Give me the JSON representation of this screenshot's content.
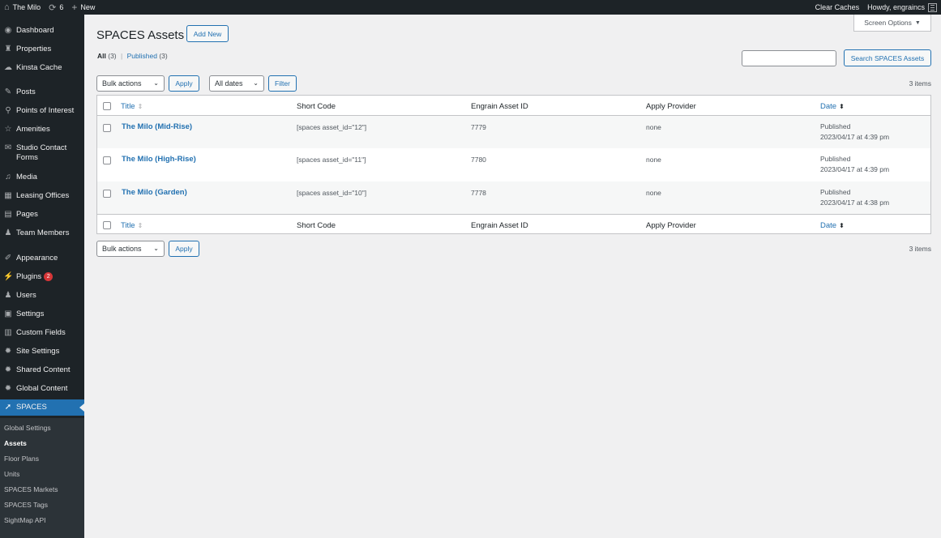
{
  "adminbar": {
    "site_name": "The Milo",
    "updates_count": "6",
    "new_label": "New",
    "clear_caches": "Clear Caches",
    "howdy": "Howdy, engraincs"
  },
  "sidebar": {
    "items": [
      {
        "label": "Dashboard",
        "icon": "dashboard-icon"
      },
      {
        "label": "Properties",
        "icon": "properties-icon"
      },
      {
        "label": "Kinsta Cache",
        "icon": "cloud-icon"
      },
      {
        "label": "Posts",
        "icon": "pin-icon"
      },
      {
        "label": "Points of Interest",
        "icon": "location-icon"
      },
      {
        "label": "Amenities",
        "icon": "star-icon"
      },
      {
        "label": "Studio Contact Forms",
        "icon": "mailbox-icon"
      },
      {
        "label": "Media",
        "icon": "media-icon"
      },
      {
        "label": "Leasing Offices",
        "icon": "building-icon"
      },
      {
        "label": "Pages",
        "icon": "page-icon"
      },
      {
        "label": "Team Members",
        "icon": "user-icon"
      },
      {
        "label": "Appearance",
        "icon": "brush-icon"
      },
      {
        "label": "Plugins",
        "icon": "plug-icon",
        "badge": "2"
      },
      {
        "label": "Users",
        "icon": "users-icon"
      },
      {
        "label": "Settings",
        "icon": "settings-icon"
      },
      {
        "label": "Custom Fields",
        "icon": "fields-icon"
      },
      {
        "label": "Site Settings",
        "icon": "gear-icon"
      },
      {
        "label": "Shared Content",
        "icon": "gear-icon"
      },
      {
        "label": "Global Content",
        "icon": "gear-icon"
      },
      {
        "label": "SPACES",
        "icon": "spaces-icon"
      }
    ],
    "submenu": [
      "Global Settings",
      "Assets",
      "Floor Plans",
      "Units",
      "SPACES Markets",
      "SPACES Tags",
      "SightMap API"
    ]
  },
  "page": {
    "title": "SPACES Assets",
    "add_new": "Add New",
    "screen_options": "Screen Options",
    "filter_all": "All",
    "filter_all_count": "(3)",
    "filter_sep": "|",
    "filter_published": "Published",
    "filter_published_count": "(3)",
    "search_value": "",
    "search_button": "Search SPACES Assets",
    "bulk_actions": "Bulk actions",
    "apply": "Apply",
    "all_dates": "All dates",
    "filter": "Filter",
    "items_count": "3 items"
  },
  "table": {
    "columns": [
      "Title",
      "Short Code",
      "Engrain Asset ID",
      "Apply Provider",
      "Date"
    ],
    "rows": [
      {
        "title": "The Milo (Mid-Rise)",
        "shortcode": "[spaces asset_id=\"12\"]",
        "asset_id": "7779",
        "provider": "none",
        "status": "Published",
        "date": "2023/04/17 at 4:39 pm"
      },
      {
        "title": "The Milo (High-Rise)",
        "shortcode": "[spaces asset_id=\"11\"]",
        "asset_id": "7780",
        "provider": "none",
        "status": "Published",
        "date": "2023/04/17 at 4:39 pm"
      },
      {
        "title": "The Milo (Garden)",
        "shortcode": "[spaces asset_id=\"10\"]",
        "asset_id": "7778",
        "provider": "none",
        "status": "Published",
        "date": "2023/04/17 at 4:38 pm"
      }
    ]
  }
}
